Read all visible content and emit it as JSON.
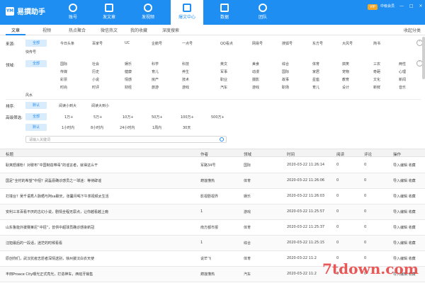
{
  "app": {
    "logo_mark": "YM",
    "name": "易撰助手",
    "vip": "VIP",
    "member": "中级会员",
    "window_buttons": "— □ ×"
  },
  "nav": [
    {
      "label": "账号",
      "icon": "user-icon"
    },
    {
      "label": "发文章",
      "icon": "edit-icon"
    },
    {
      "label": "发视频",
      "icon": "video-icon"
    },
    {
      "label": "爆文中心",
      "icon": "hot-icon"
    },
    {
      "label": "数据",
      "icon": "bar-chart-icon"
    },
    {
      "label": "团队",
      "icon": "team-icon"
    }
  ],
  "subtabs": [
    "文章",
    "视频",
    "热点聚合",
    "微信热文",
    "我的收藏",
    "深度搜索"
  ],
  "collect_label": "收起分类",
  "filters": {
    "source_label": "来源:",
    "source_all": "全部",
    "sources": [
      "今日头条",
      "百家号",
      "UC",
      "企鹅号",
      "一点号",
      "QQ看点",
      "网易号",
      "搜狐号",
      "东方号",
      "大风号",
      "简书"
    ],
    "sources_row2": [
      "快传号"
    ],
    "domain_label": "领域:",
    "domain_all": "全部",
    "domains": [
      [
        "国际",
        "社会",
        "娱乐",
        "科学",
        "科技",
        "英文",
        "美食",
        "综合",
        "体育",
        "搞笑",
        "三农",
        "两性"
      ],
      [
        "传媒",
        "历史",
        "健康",
        "育儿",
        "养生",
        "军事",
        "动漫",
        "国际",
        "家居",
        "宠物",
        "奇葩",
        "心理"
      ],
      [
        "彩票",
        "小说",
        "情感",
        "房产",
        "技术",
        "职业",
        "摄影",
        "故事",
        "星座",
        "教育",
        "文化",
        "新闻"
      ],
      [
        "时尚",
        "时评",
        "财经",
        "旅游",
        "游戏",
        "汽车",
        "游戏",
        "职场",
        "育儿",
        "设计",
        "新鲜",
        "音乐"
      ],
      [
        "风水"
      ]
    ],
    "sort_label": "排序:",
    "sort_options": [
      "默认",
      "阅读小到大",
      "阅读大到小"
    ],
    "advanced_label": "高级筛选:",
    "read_options": [
      "全部",
      "1万+",
      "5万+",
      "10万+",
      "50万+",
      "100万+",
      "500万+"
    ],
    "time_options": [
      "默认",
      "1小时内",
      "8小时内",
      "24小时内",
      "1周内",
      "30天"
    ],
    "search_placeholder": "请输入关键词"
  },
  "table": {
    "headers": [
      "标题",
      "作者",
      "领域",
      "时间",
      "阅读",
      "评论",
      "操作"
    ],
    "rows": [
      {
        "title": "耿爽怒爆粉！对歇布“中国制造带毒”的谣言者，就得这么干",
        "author": "军路34号",
        "field": "国际",
        "time": "2020-03-22 11:26:14",
        "reads": "0",
        "comments": "0",
        "actions": "导入编辑  收藏"
      },
      {
        "title": "国足“全村的希望”中招？武磊县确诊感员之一球迷：等待辟谣",
        "author": "葫莲懂热",
        "field": "体育",
        "time": "2020-03-22 11:26:06",
        "reads": "0",
        "comments": "0",
        "actions": "导入编辑  收藏"
      },
      {
        "title": "打撞台？吴千语秀人脉晒与阿sa聊天，张馨月喝下午茶视频太生活",
        "author": "影视剧视界",
        "field": "娱乐",
        "time": "2020-03-22 11:26:03",
        "reads": "0",
        "comments": "0",
        "actions": "导入编辑  收藏"
      },
      {
        "title": "安利三本百看不厌的古幻小说，剧情全程无尿点，让你越看越上瘾",
        "author": "1",
        "field": "游戏",
        "time": "2020-03-22 11:25:57",
        "reads": "0",
        "comments": "0",
        "actions": "导入编辑  收藏"
      },
      {
        "title": "山东鲁能外援赛莱尼“中招”，曾供中超球员确诊感染新冠",
        "author": "南方都市报",
        "field": "体育",
        "time": "2020-03-22 11:25:37",
        "reads": "0",
        "comments": "0",
        "actions": "导入编辑  收藏"
      },
      {
        "title": "汪妲最后的一段话，迷茫的时候看看",
        "author": "1",
        "field": "综合",
        "time": "2020-03-22 11:25:15",
        "reads": "0",
        "comments": "0",
        "actions": "导入编辑  收藏"
      },
      {
        "title": "原创你们，武汉抗疫志愿者深情送别，徐州援汉白衣天使",
        "author": "说芒飞",
        "field": "体育",
        "time": "2020-03-22 11:2",
        "reads": "0",
        "comments": "0",
        "actions": "导入编辑  收藏"
      },
      {
        "title": "丰田Proace City曝光正式亮光，打造神车，西班牙销售",
        "author": "葫莲懂热",
        "field": "汽车",
        "time": "2020-03-22 11:2",
        "reads": "0",
        "comments": "0",
        "actions": "导入编辑  收藏"
      }
    ]
  },
  "watermark": "7tdown.com",
  "colors": {
    "primary": "#1f8ef2",
    "chip_bg": "#d9ecfd",
    "vip": "#f5a623",
    "watermark": "#e83b3b"
  }
}
